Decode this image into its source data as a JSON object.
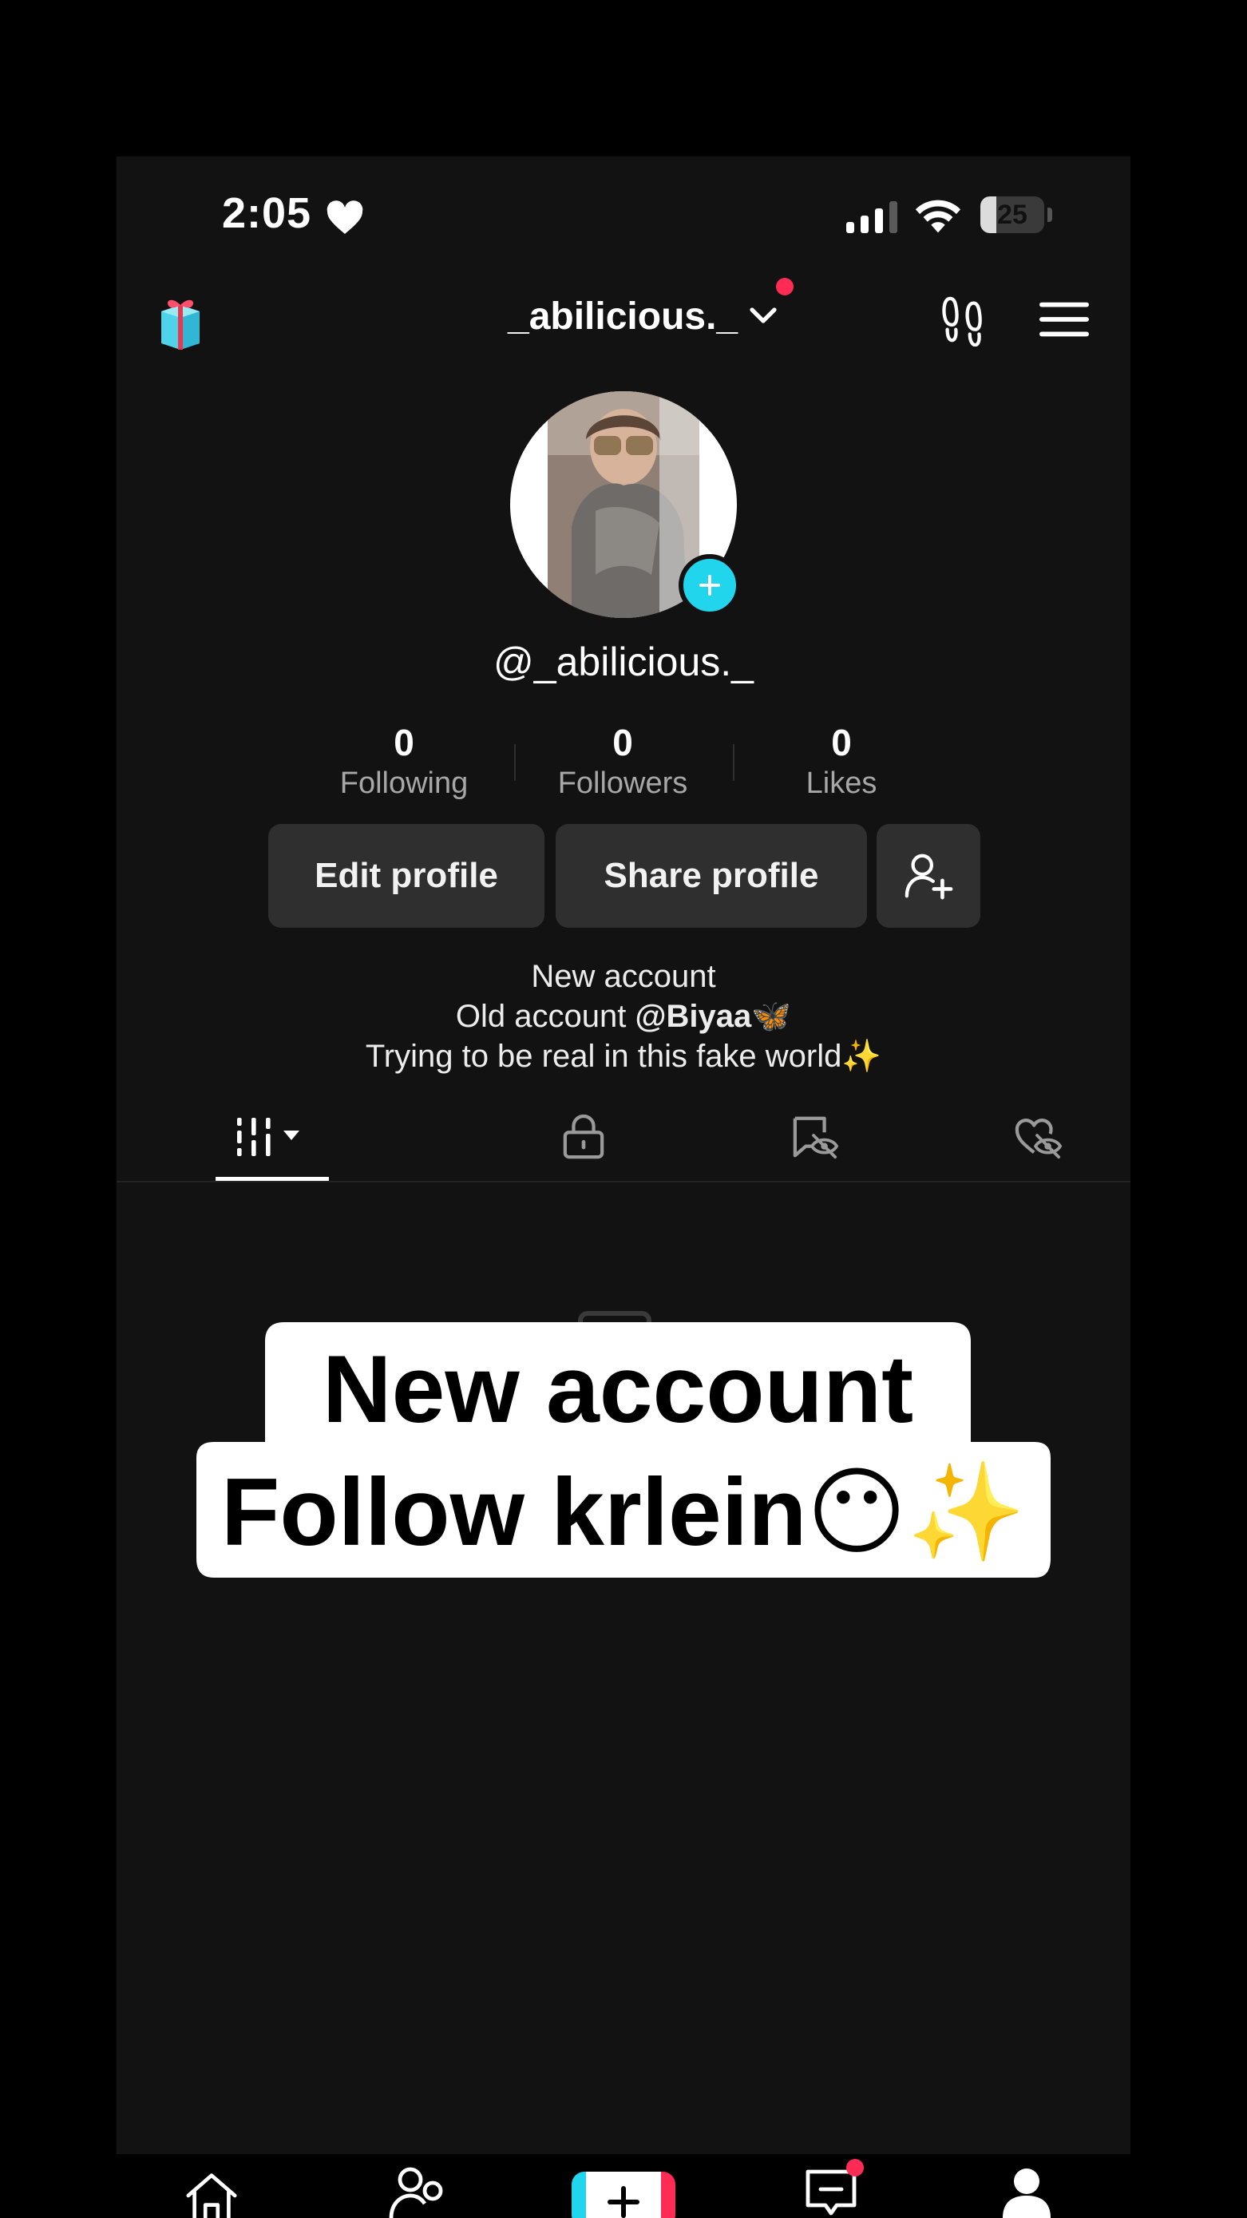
{
  "status_bar": {
    "time": "2:05",
    "battery_level": "25",
    "battery_fraction": 0.25
  },
  "header": {
    "account_name": "_abilicious._",
    "has_notification": true
  },
  "profile": {
    "handle": "@_abilicious._",
    "stats": [
      {
        "value": "0",
        "label": "Following"
      },
      {
        "value": "0",
        "label": "Followers"
      },
      {
        "value": "0",
        "label": "Likes"
      }
    ],
    "buttons": {
      "edit": "Edit profile",
      "share": "Share profile"
    },
    "bio": {
      "line1": "New account",
      "line2_prefix": "Old account ",
      "line2_mention": "@Biyaa",
      "line2_emoji": "🦋",
      "line3_text": "Trying to be real in this fake world",
      "line3_emoji": "✨"
    }
  },
  "tabs": [
    "videos",
    "private",
    "reposts-hidden",
    "liked-hidden"
  ],
  "overlay_caption": {
    "line1": "New account",
    "line2_text": "Follow krlein",
    "line2_emoji_face": "😶",
    "line2_emoji_sparkle": "✨"
  },
  "colors": {
    "background": "#121212",
    "accent_cyan": "#20d5ec",
    "accent_red": "#fe2c55",
    "button_bg": "#2f2f2f",
    "muted_text": "#a7a7a7"
  },
  "bottom_nav": [
    "home",
    "friends",
    "create",
    "inbox",
    "profile"
  ]
}
